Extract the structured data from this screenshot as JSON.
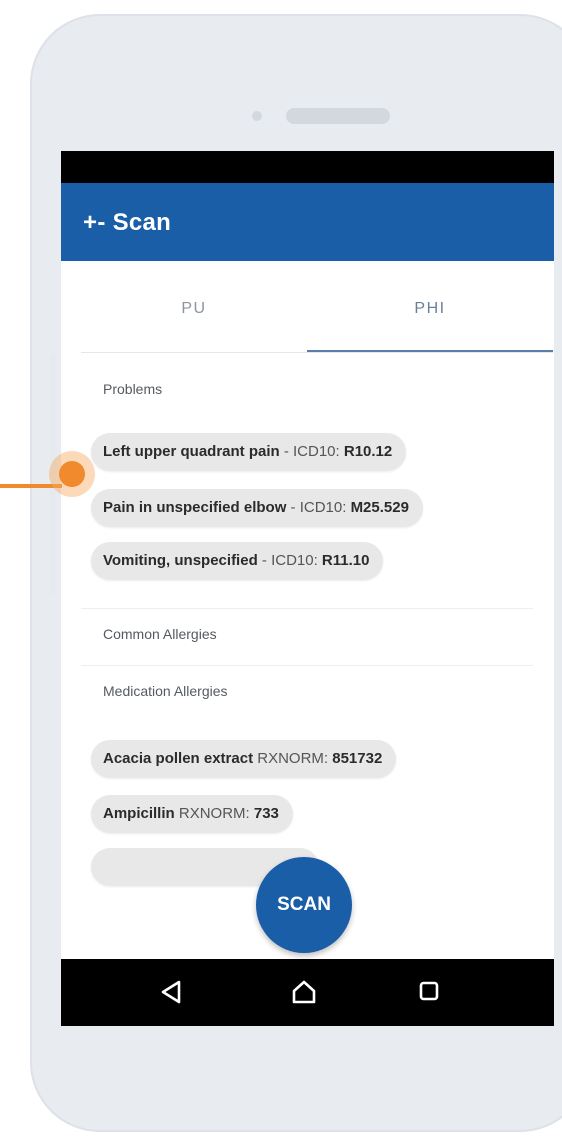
{
  "app": {
    "title": "+-  Scan",
    "accent_color": "#1a5ea8"
  },
  "tabs": [
    {
      "label": "PU",
      "active": false
    },
    {
      "label": "PHI",
      "active": true
    }
  ],
  "sections": {
    "problems": {
      "label": "Problems",
      "items": [
        {
          "name": "Left upper quadrant pain",
          "system": " - ICD10: ",
          "code": "R10.12"
        },
        {
          "name": "Pain in unspecified elbow",
          "system": " - ICD10: ",
          "code": "M25.529"
        },
        {
          "name": "Vomiting, unspecified",
          "system": " - ICD10: ",
          "code": "R11.10"
        }
      ]
    },
    "common_allergies": {
      "label": "Common Allergies"
    },
    "medication_allergies": {
      "label": "Medication Allergies",
      "items": [
        {
          "name": "Acacia pollen extract",
          "system": " RXNORM: ",
          "code": "851732"
        },
        {
          "name": "Ampicillin",
          "system": " RXNORM: ",
          "code": "733"
        }
      ]
    }
  },
  "fab": {
    "label": "SCAN"
  },
  "navbar": {
    "icons": [
      "back-triangle-icon",
      "home-icon",
      "recent-apps-icon"
    ]
  },
  "callout": {
    "color": "#f08a2c"
  }
}
